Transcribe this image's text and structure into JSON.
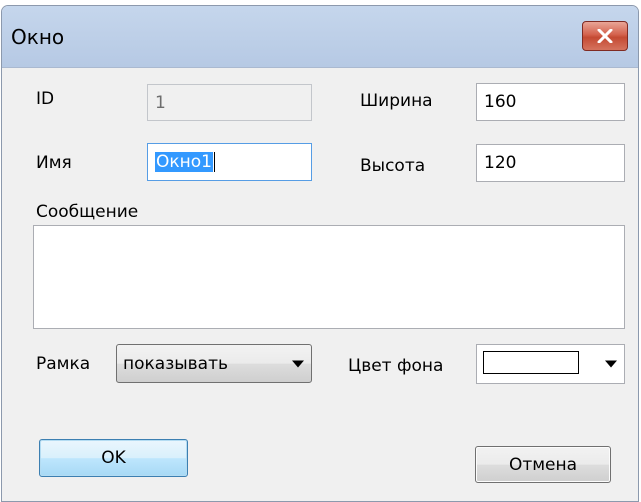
{
  "window": {
    "title": "Окно"
  },
  "form": {
    "id_label": "ID",
    "id_value": "1",
    "name_label": "Имя",
    "name_value": "Окно1",
    "width_label": "Ширина",
    "width_value": "160",
    "height_label": "Высота",
    "height_value": "120",
    "message_label": "Сообщение",
    "message_value": "",
    "border_label": "Рамка",
    "border_value": "показывать",
    "bgcolor_label": "Цвет фона",
    "bgcolor_value": "#ffffff"
  },
  "buttons": {
    "ok_label": "OK",
    "cancel_label": "Отмена"
  },
  "colors": {
    "accent": "#3399ff",
    "close_button": "#c44a33",
    "titlebar": "#c5d6ec",
    "dialog_bg": "#f0f0f0"
  },
  "icons": {
    "close": "close-icon",
    "dropdown": "chevron-down-icon"
  }
}
